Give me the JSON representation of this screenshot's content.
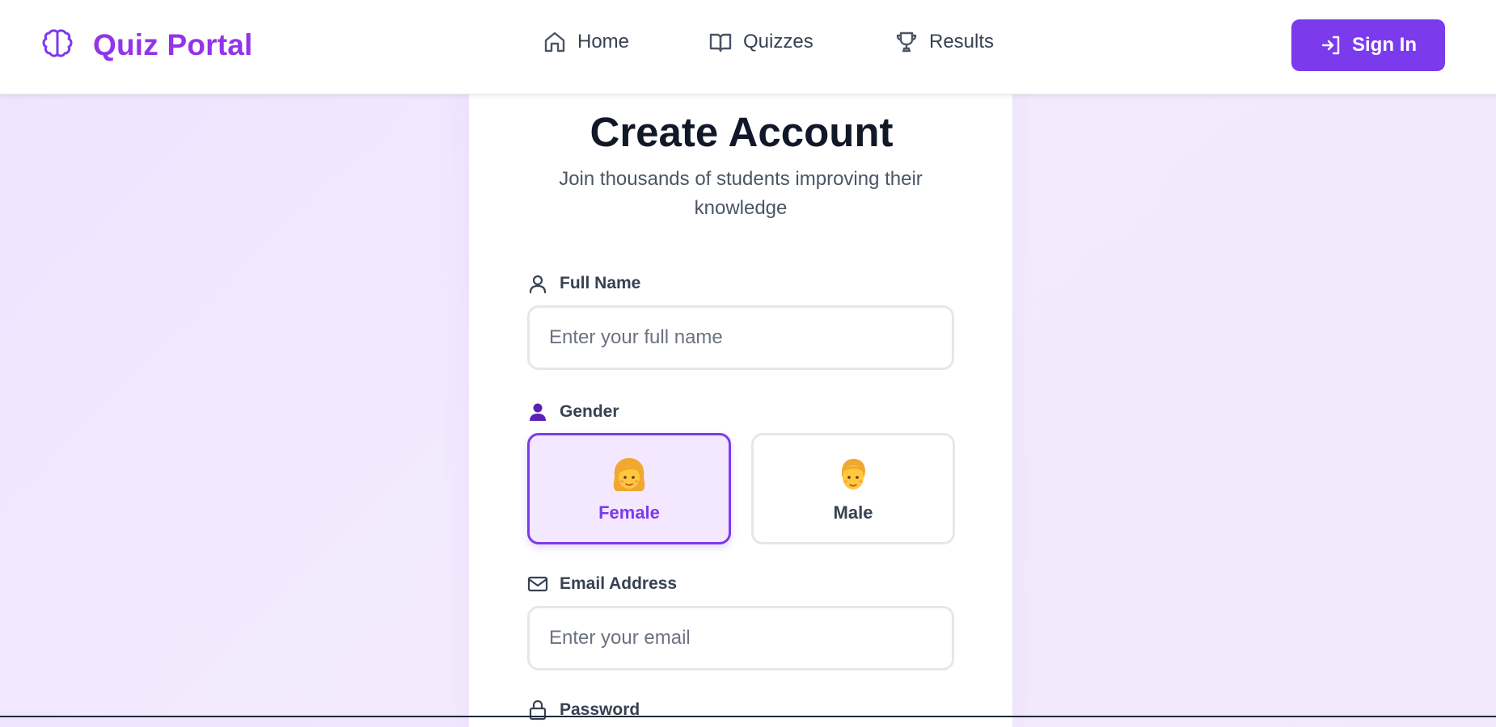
{
  "nav": {
    "brand": "Quiz Portal",
    "links": [
      {
        "label": "Home",
        "icon": "home-icon"
      },
      {
        "label": "Quizzes",
        "icon": "book-icon"
      },
      {
        "label": "Results",
        "icon": "trophy-icon"
      }
    ],
    "signin_label": "Sign In",
    "signin_icon": "sign-in-icon"
  },
  "form": {
    "title": "Create Account",
    "subtitle": "Join thousands of students improving their knowledge",
    "full_name": {
      "label": "Full Name",
      "placeholder": "Enter your full name",
      "value": ""
    },
    "gender": {
      "label": "Gender",
      "selected": "Female",
      "options": [
        {
          "label": "Female",
          "emoji": "👩"
        },
        {
          "label": "Male",
          "emoji": "👨"
        }
      ]
    },
    "email": {
      "label": "Email Address",
      "placeholder": "Enter your email",
      "value": ""
    },
    "password": {
      "label": "Password"
    }
  },
  "colors": {
    "brand": "#9333ea",
    "primary": "#7c3aed",
    "selected_bg": "#f3e8ff",
    "page_bg": "#efe3ff"
  }
}
